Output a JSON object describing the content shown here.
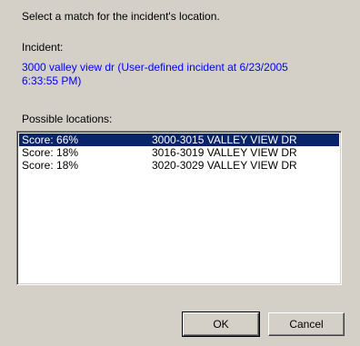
{
  "dialog": {
    "instruction": "Select a match for the incident's location.",
    "incident_label": "Incident:",
    "incident_description": "3000 valley view dr (User-defined incident at 6/23/2005 6:33:55 PM)",
    "possible_locations_label": "Possible locations:"
  },
  "locations": [
    {
      "score": "Score: 66%",
      "range": "3000-3015 VALLEY VIEW DR",
      "selected": true
    },
    {
      "score": "Score: 18%",
      "range": "3016-3019 VALLEY VIEW DR",
      "selected": false
    },
    {
      "score": "Score: 18%",
      "range": "3020-3029 VALLEY VIEW DR",
      "selected": false
    }
  ],
  "buttons": {
    "ok_label": "OK",
    "cancel_label": "Cancel"
  },
  "colors": {
    "background": "#d4d0c8",
    "selection": "#0a246a",
    "incident_text": "#0000ff"
  }
}
